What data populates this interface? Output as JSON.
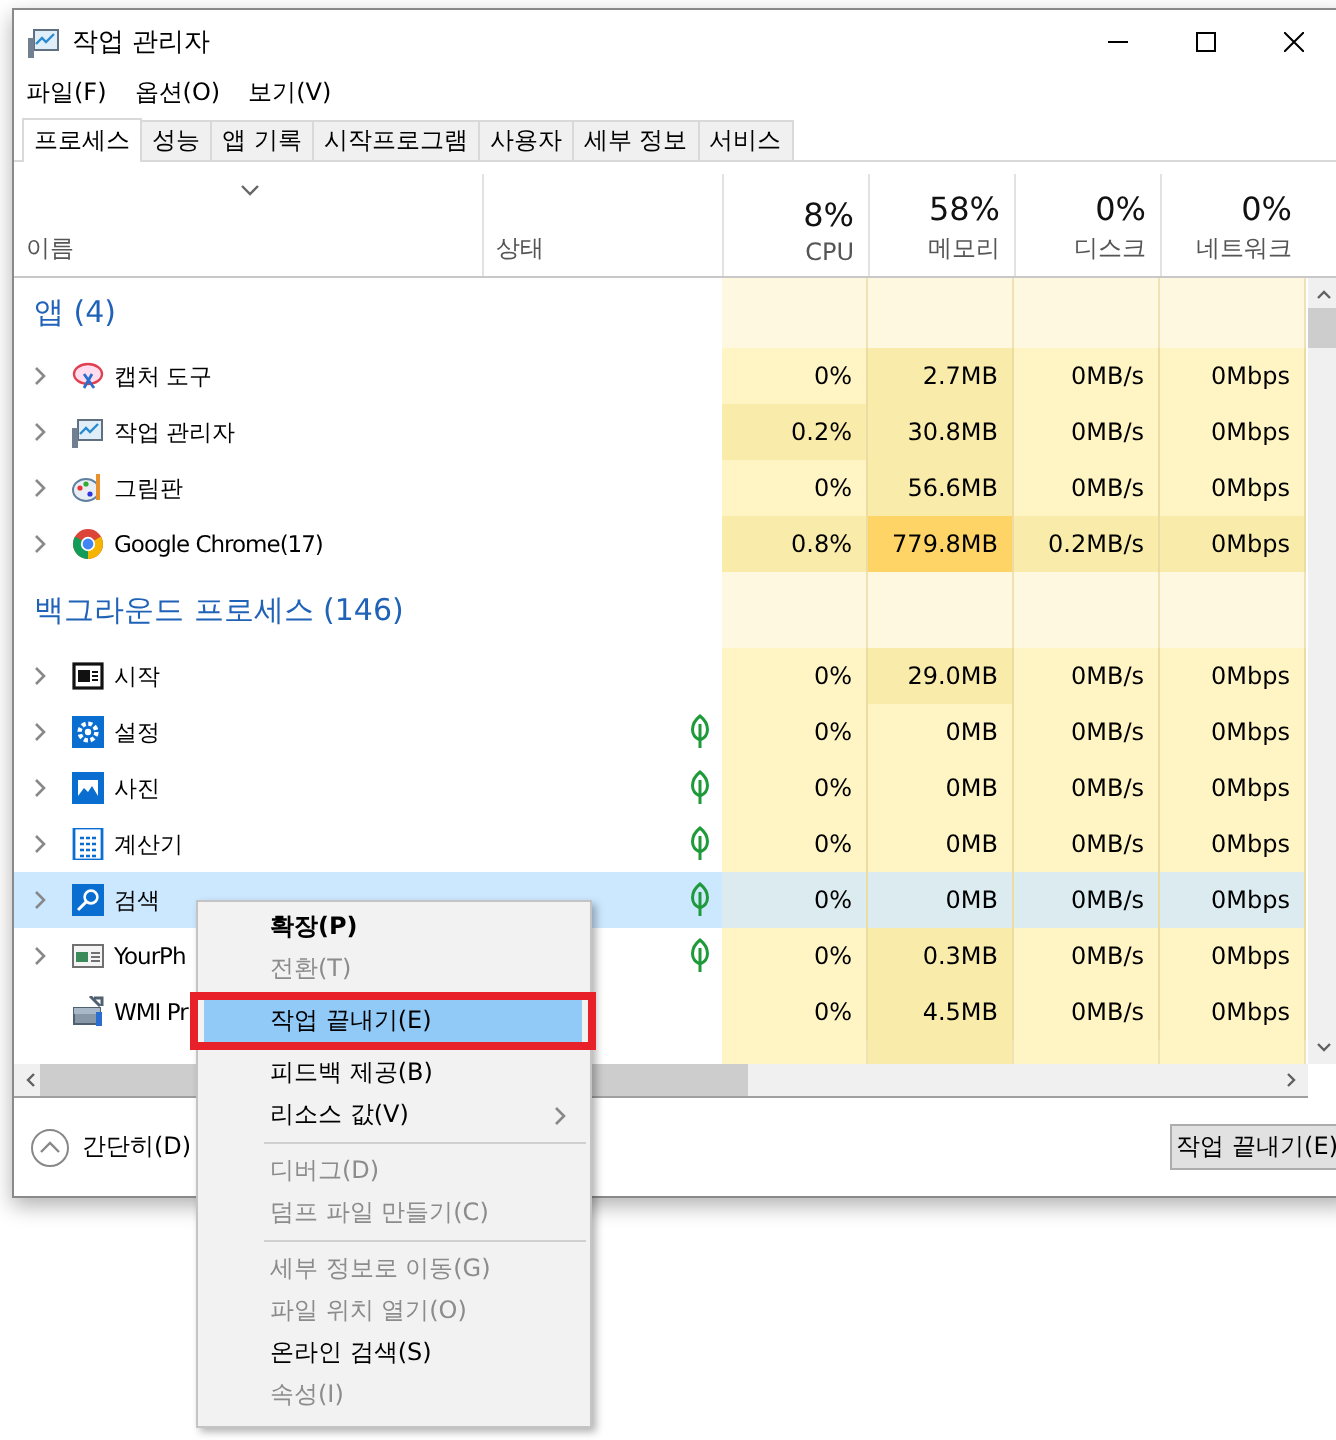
{
  "window": {
    "title": "작업 관리자"
  },
  "menu_bar": [
    "파일(F)",
    "옵션(O)",
    "보기(V)"
  ],
  "tabs": [
    {
      "label": "프로세스",
      "selected": true
    },
    {
      "label": "성능",
      "selected": false
    },
    {
      "label": "앱 기록",
      "selected": false
    },
    {
      "label": "시작프로그램",
      "selected": false
    },
    {
      "label": "사용자",
      "selected": false
    },
    {
      "label": "세부 정보",
      "selected": false
    },
    {
      "label": "서비스",
      "selected": false
    }
  ],
  "columns": [
    {
      "label": "이름"
    },
    {
      "label": "상태"
    },
    {
      "usage": "8%",
      "label": "CPU"
    },
    {
      "usage": "58%",
      "label": "메모리"
    },
    {
      "usage": "0%",
      "label": "디스크"
    },
    {
      "usage": "0%",
      "label": "네트워크"
    }
  ],
  "groups": [
    {
      "title": "앱 (4)",
      "rows": [
        {
          "name": "캡처 도구",
          "expandable": true,
          "suspended": false,
          "selected": false,
          "cells": [
            {
              "text": "0%",
              "color": "#fff4c4"
            },
            {
              "text": "2.7MB",
              "color": "#f9ecab"
            },
            {
              "text": "0MB/s",
              "color": "#fff4c4"
            },
            {
              "text": "0Mbps",
              "color": "#fff4c4"
            }
          ]
        },
        {
          "name": "작업 관리자",
          "expandable": true,
          "suspended": false,
          "selected": false,
          "cells": [
            {
              "text": "0.2%",
              "color": "#f9ecab"
            },
            {
              "text": "30.8MB",
              "color": "#f9ecab"
            },
            {
              "text": "0MB/s",
              "color": "#fff4c4"
            },
            {
              "text": "0Mbps",
              "color": "#fff4c4"
            }
          ]
        },
        {
          "name": "그림판",
          "expandable": true,
          "suspended": false,
          "selected": false,
          "cells": [
            {
              "text": "0%",
              "color": "#fff4c4"
            },
            {
              "text": "56.6MB",
              "color": "#f9ecab"
            },
            {
              "text": "0MB/s",
              "color": "#fff4c4"
            },
            {
              "text": "0Mbps",
              "color": "#fff4c4"
            }
          ]
        },
        {
          "name": "Google Chrome(17)",
          "expandable": true,
          "suspended": false,
          "selected": false,
          "cells": [
            {
              "text": "0.8%",
              "color": "#f9ecab"
            },
            {
              "text": "779.8MB",
              "color": "#ffd467"
            },
            {
              "text": "0.2MB/s",
              "color": "#f9ecab"
            },
            {
              "text": "0Mbps",
              "color": "#f9ecab"
            }
          ]
        }
      ]
    },
    {
      "title": "백그라운드 프로세스 (146)",
      "rows": [
        {
          "name": "시작",
          "expandable": true,
          "suspended": false,
          "selected": false,
          "cells": [
            {
              "text": "0%",
              "color": "#fff4c4"
            },
            {
              "text": "29.0MB",
              "color": "#f9ecab"
            },
            {
              "text": "0MB/s",
              "color": "#fff4c4"
            },
            {
              "text": "0Mbps",
              "color": "#fff4c4"
            }
          ]
        },
        {
          "name": "설정",
          "expandable": true,
          "suspended": true,
          "selected": false,
          "cells": [
            {
              "text": "0%",
              "color": "#fff4c4"
            },
            {
              "text": "0MB",
              "color": "#fff4c4"
            },
            {
              "text": "0MB/s",
              "color": "#fff4c4"
            },
            {
              "text": "0Mbps",
              "color": "#fff4c4"
            }
          ]
        },
        {
          "name": "사진",
          "expandable": true,
          "suspended": true,
          "selected": false,
          "cells": [
            {
              "text": "0%",
              "color": "#fff4c4"
            },
            {
              "text": "0MB",
              "color": "#fff4c4"
            },
            {
              "text": "0MB/s",
              "color": "#fff4c4"
            },
            {
              "text": "0Mbps",
              "color": "#fff4c4"
            }
          ]
        },
        {
          "name": "계산기",
          "expandable": true,
          "suspended": true,
          "selected": false,
          "cells": [
            {
              "text": "0%",
              "color": "#fff4c4"
            },
            {
              "text": "0MB",
              "color": "#fff4c4"
            },
            {
              "text": "0MB/s",
              "color": "#fff4c4"
            },
            {
              "text": "0Mbps",
              "color": "#fff4c4"
            }
          ]
        },
        {
          "name": "검색",
          "expandable": true,
          "suspended": true,
          "selected": true,
          "cells": [
            {
              "text": "0%",
              "color": "#dcebf0"
            },
            {
              "text": "0MB",
              "color": "#dcebf0"
            },
            {
              "text": "0MB/s",
              "color": "#dcebf0"
            },
            {
              "text": "0Mbps",
              "color": "#dcebf0"
            }
          ]
        },
        {
          "name": "YourPh",
          "expandable": true,
          "suspended": true,
          "selected": false,
          "cells": [
            {
              "text": "0%",
              "color": "#fff4c4"
            },
            {
              "text": "0.3MB",
              "color": "#f9ecab"
            },
            {
              "text": "0MB/s",
              "color": "#fff4c4"
            },
            {
              "text": "0Mbps",
              "color": "#fff4c4"
            }
          ]
        },
        {
          "name": "WMI Pr",
          "expandable": false,
          "suspended": false,
          "selected": false,
          "cells": [
            {
              "text": "0%",
              "color": "#fff4c4"
            },
            {
              "text": "4.5MB",
              "color": "#f9ecab"
            },
            {
              "text": "0MB/s",
              "color": "#fff4c4"
            },
            {
              "text": "0Mbps",
              "color": "#fff4c4"
            }
          ]
        }
      ]
    }
  ],
  "footer": {
    "collapse_label": "간단히(D)",
    "end_task_button": "작업 끝내기(E)"
  },
  "context_menu": {
    "groups": [
      [
        {
          "label": "확장(P)",
          "bold": true,
          "disabled": false,
          "selected": false,
          "submenu": false
        },
        {
          "label": "전환(T)",
          "bold": false,
          "disabled": true,
          "selected": false,
          "submenu": false
        },
        {
          "label": "작업 끝내기(E)",
          "bold": false,
          "disabled": false,
          "selected": true,
          "submenu": false
        },
        {
          "label": "피드백 제공(B)",
          "bold": false,
          "disabled": false,
          "selected": false,
          "submenu": false
        },
        {
          "label": "리소스 값(V)",
          "bold": false,
          "disabled": false,
          "selected": false,
          "submenu": true
        }
      ],
      [
        {
          "label": "디버그(D)",
          "bold": false,
          "disabled": true,
          "selected": false,
          "submenu": false
        },
        {
          "label": "덤프 파일 만들기(C)",
          "bold": false,
          "disabled": true,
          "selected": false,
          "submenu": false
        }
      ],
      [
        {
          "label": "세부 정보로 이동(G)",
          "bold": false,
          "disabled": true,
          "selected": false,
          "submenu": false
        },
        {
          "label": "파일 위치 열기(O)",
          "bold": false,
          "disabled": true,
          "selected": false,
          "submenu": false
        },
        {
          "label": "온라인 검색(S)",
          "bold": false,
          "disabled": false,
          "selected": false,
          "submenu": false
        },
        {
          "label": "속성(I)",
          "bold": false,
          "disabled": true,
          "selected": false,
          "submenu": false
        }
      ]
    ]
  }
}
